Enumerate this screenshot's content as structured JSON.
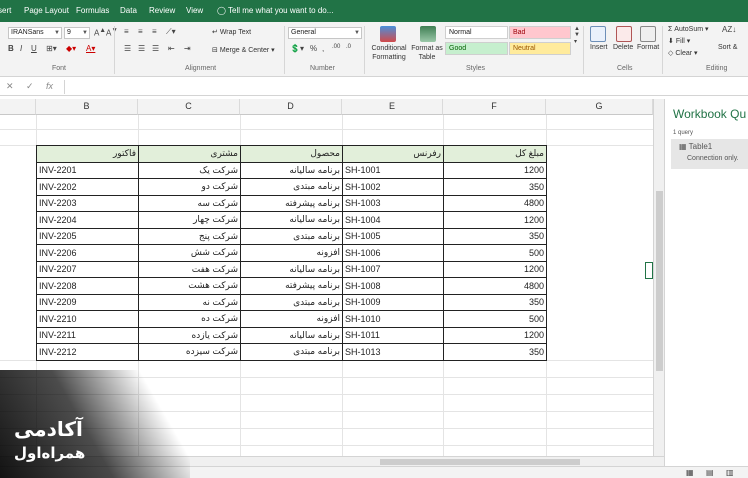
{
  "tabs": [
    "sert",
    "Page Layout",
    "Formulas",
    "Data",
    "Review",
    "View"
  ],
  "tell_me": "Tell me what you want to do...",
  "font": {
    "name": "IRANSans",
    "size": "9",
    "group_label": "Font"
  },
  "alignment": {
    "wrap_text": "Wrap Text",
    "merge_center": "Merge & Center",
    "group_label": "Alignment"
  },
  "number": {
    "format": "General",
    "group_label": "Number"
  },
  "styles": {
    "conditional_formatting": "Conditional Formatting",
    "format_as_table": "Format as Table",
    "normal": "Normal",
    "bad": "Bad",
    "good": "Good",
    "neutral": "Neutral",
    "group_label": "Styles",
    "colors": {
      "bad_bg": "#ffc7ce",
      "bad_fg": "#9c0006",
      "good_bg": "#c6efce",
      "good_fg": "#006100",
      "neutral_bg": "#ffeb9c",
      "neutral_fg": "#9c5700"
    }
  },
  "cells": {
    "insert": "Insert",
    "delete": "Delete",
    "format": "Format",
    "group_label": "Cells"
  },
  "editing": {
    "autosum": "AutoSum",
    "fill": "Fill",
    "clear": "Clear",
    "sort_filter": "Sort &",
    "group_label": "Editing"
  },
  "columns": [
    "B",
    "C",
    "D",
    "E",
    "F",
    "G"
  ],
  "table": {
    "headers": {
      "b": "فاکتور",
      "c": "مشتری",
      "d": "محصول",
      "e": "رفرنس",
      "f": "مبلغ کل"
    },
    "rows": [
      {
        "b": "INV-2201",
        "c": "شرکت یک",
        "d": "برنامه سالیانه",
        "e": "SH-1001",
        "f": "1200"
      },
      {
        "b": "INV-2202",
        "c": "شرکت دو",
        "d": "برنامه مبتدی",
        "e": "SH-1002",
        "f": "350"
      },
      {
        "b": "INV-2203",
        "c": "شرکت سه",
        "d": "برنامه پیشرفته",
        "e": "SH-1003",
        "f": "4800"
      },
      {
        "b": "INV-2204",
        "c": "شرکت چهار",
        "d": "برنامه سالیانه",
        "e": "SH-1004",
        "f": "1200"
      },
      {
        "b": "INV-2205",
        "c": "شرکت پنج",
        "d": "برنامه مبتدی",
        "e": "SH-1005",
        "f": "350"
      },
      {
        "b": "INV-2206",
        "c": "شرکت شش",
        "d": "افزونه",
        "e": "SH-1006",
        "f": "500"
      },
      {
        "b": "INV-2207",
        "c": "شرکت هفت",
        "d": "برنامه سالیانه",
        "e": "SH-1007",
        "f": "1200"
      },
      {
        "b": "INV-2208",
        "c": "شرکت هشت",
        "d": "برنامه پیشرفته",
        "e": "SH-1008",
        "f": "4800"
      },
      {
        "b": "INV-2209",
        "c": "شرکت نه",
        "d": "برنامه مبتدی",
        "e": "SH-1009",
        "f": "350"
      },
      {
        "b": "INV-2210",
        "c": "شرکت ده",
        "d": "افزونه",
        "e": "SH-1010",
        "f": "500"
      },
      {
        "b": "INV-2211",
        "c": "شرکت یازده",
        "d": "برنامه سالیانه",
        "e": "SH-1011",
        "f": "1200"
      },
      {
        "b": "INV-2212",
        "c": "شرکت سیزده",
        "d": "برنامه مبتدی",
        "e": "SH-1013",
        "f": "350"
      }
    ]
  },
  "pane": {
    "title": "Workbook Qu",
    "count": "1 query",
    "query_name": "Table1",
    "query_status": "Connection only."
  },
  "watermark": {
    "line1": "آکادمی",
    "line2": "همراه‌اول"
  },
  "accent": "#217346"
}
